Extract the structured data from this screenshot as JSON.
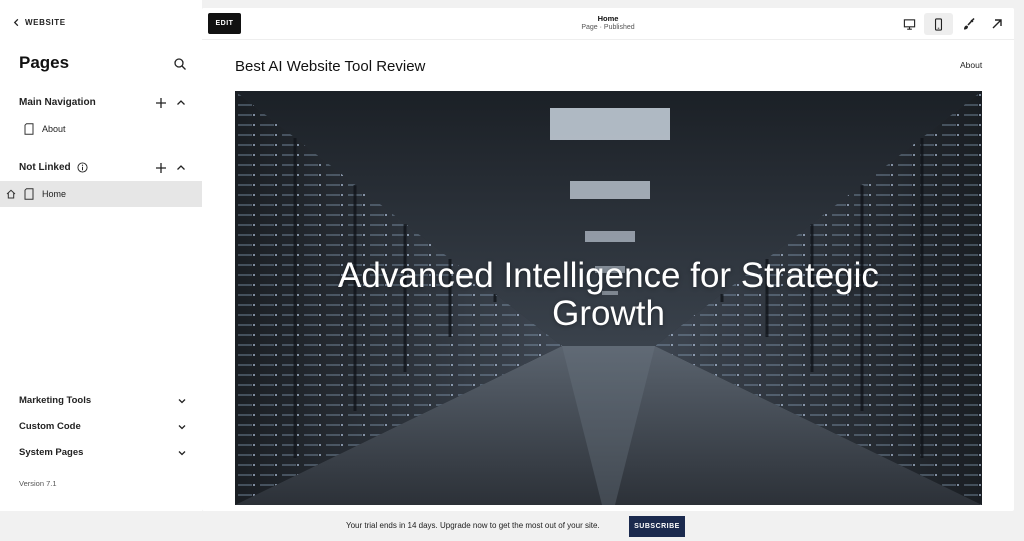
{
  "sidebar": {
    "back_label": "WEBSITE",
    "title": "Pages",
    "main_navigation": {
      "label": "Main Navigation",
      "items": [
        {
          "label": "About"
        }
      ]
    },
    "not_linked": {
      "label": "Not Linked",
      "items": [
        {
          "label": "Home",
          "selected": true
        }
      ]
    },
    "sections": [
      {
        "label": "Marketing Tools"
      },
      {
        "label": "Custom Code"
      },
      {
        "label": "System Pages"
      }
    ],
    "version": "Version 7.1"
  },
  "topbar": {
    "edit_label": "EDIT",
    "page_title": "Home",
    "page_status": "Page · Published",
    "view_mode": "mobile"
  },
  "site": {
    "title": "Best AI Website Tool Review",
    "nav": [
      {
        "label": "About"
      }
    ],
    "hero_heading": "Advanced Intelligence for Strategic Growth"
  },
  "banner": {
    "text": "Your trial ends in 14 days. Upgrade now to get the most out of your site.",
    "button_label": "SUBSCRIBE",
    "button_color": "#1b2a4e"
  },
  "icons": {
    "back": "chevron-left-icon",
    "search": "search-icon",
    "add": "plus-icon",
    "collapse": "chevron-up-icon",
    "expand": "chevron-down-icon",
    "info": "info-icon",
    "page": "page-icon",
    "home": "home-icon",
    "desktop": "desktop-icon",
    "mobile": "mobile-icon",
    "design": "paintbrush-icon",
    "external": "arrow-up-right-icon"
  }
}
